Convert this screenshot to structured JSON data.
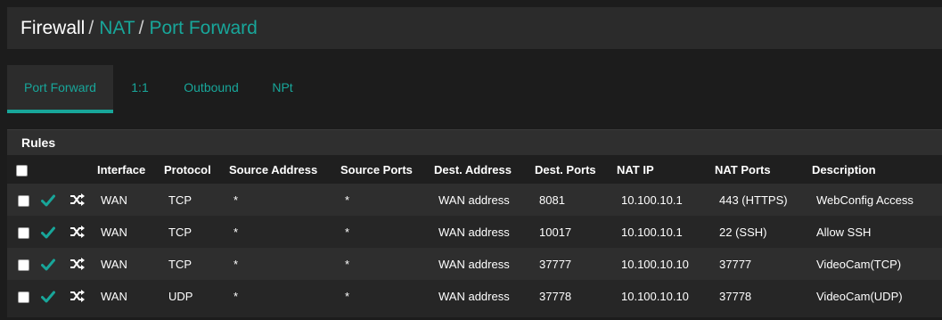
{
  "breadcrumb": {
    "root": "Firewall",
    "sep1": "/",
    "nat": "NAT",
    "sep2": "/",
    "current": "Port Forward"
  },
  "tabs": [
    {
      "label": "Port Forward",
      "active": true
    },
    {
      "label": "1:1",
      "active": false
    },
    {
      "label": "Outbound",
      "active": false
    },
    {
      "label": "NPt",
      "active": false
    }
  ],
  "panel": {
    "title": "Rules",
    "columns": [
      "Interface",
      "Protocol",
      "Source Address",
      "Source Ports",
      "Dest. Address",
      "Dest. Ports",
      "NAT IP",
      "NAT Ports",
      "Description"
    ]
  },
  "rows": [
    {
      "interface": "WAN",
      "protocol": "TCP",
      "src_addr": "*",
      "src_ports": "*",
      "dest_addr": "WAN address",
      "dest_ports": "8081",
      "nat_ip": "10.100.10.1",
      "nat_ports": "443 (HTTPS)",
      "description": "WebConfig Access"
    },
    {
      "interface": "WAN",
      "protocol": "TCP",
      "src_addr": "*",
      "src_ports": "*",
      "dest_addr": "WAN address",
      "dest_ports": "10017",
      "nat_ip": "10.100.10.1",
      "nat_ports": "22 (SSH)",
      "description": "Allow SSH"
    },
    {
      "interface": "WAN",
      "protocol": "TCP",
      "src_addr": "*",
      "src_ports": "*",
      "dest_addr": "WAN address",
      "dest_ports": "37777",
      "nat_ip": "10.100.10.10",
      "nat_ports": "37777",
      "description": "VideoCam(TCP)"
    },
    {
      "interface": "WAN",
      "protocol": "UDP",
      "src_addr": "*",
      "src_ports": "*",
      "dest_addr": "WAN address",
      "dest_ports": "37778",
      "nat_ip": "10.100.10.10",
      "nat_ports": "37778",
      "description": "VideoCam(UDP)"
    }
  ],
  "colors": {
    "accent": "#18a69a",
    "background": "#1c1c1c",
    "panel": "#262626",
    "row_alt": "#2e2e2e"
  },
  "icons": {
    "enabled": "check-icon",
    "linked": "shuffle-icon"
  }
}
